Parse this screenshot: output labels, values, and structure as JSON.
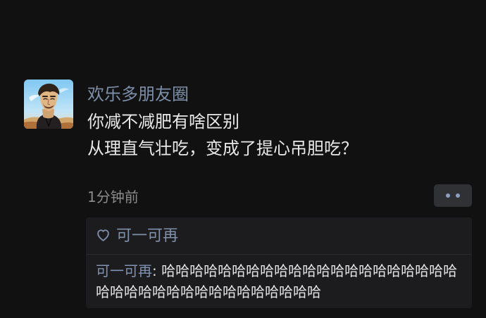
{
  "post": {
    "username": "欢乐多朋友圈",
    "text_lines": [
      "你减不减肥有啥区别",
      "从理直气壮吃，变成了提心吊胆吃？"
    ],
    "timestamp": "1分钟前"
  },
  "likes": {
    "names": [
      "可一可再"
    ]
  },
  "comments": [
    {
      "author": "可一可再",
      "separator": ": ",
      "text": "哈哈哈哈哈哈哈哈哈哈哈哈哈哈哈哈哈哈哈哈哈哈哈哈哈哈哈哈哈哈哈哈哈哈哈哈哈"
    }
  ],
  "icons": {
    "heart": "heart-icon",
    "more": "more-icon"
  },
  "colors": {
    "background": "#111111",
    "username": "#7d8ea9",
    "text": "#e9e9e9",
    "timestamp": "#8b8b8b",
    "panel": "#1c1c1e",
    "accent": "#8093b2"
  }
}
